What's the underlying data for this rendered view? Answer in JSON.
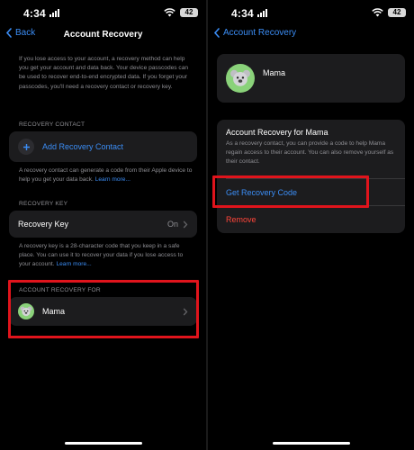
{
  "status_bar": {
    "time": "4:34",
    "battery": "42"
  },
  "left": {
    "back_label": "Back",
    "title": "Account Recovery",
    "intro": "If you lose access to your account, a recovery method can help you get your account and data back. Your device passcodes can be used to recover end-to-end encrypted data. If you forget your passcodes, you'll need a recovery contact or recovery key.",
    "recovery_contact_header": "RECOVERY CONTACT",
    "add_contact_label": "Add Recovery Contact",
    "contact_footer_text": "A recovery contact can generate a code from their Apple device to help you get your data back.",
    "learn_more": "Learn more...",
    "recovery_key_header": "RECOVERY KEY",
    "recovery_key_label": "Recovery Key",
    "recovery_key_value": "On",
    "key_footer_text": "A recovery key is a 28-character code that you keep in a safe place. You can use it to recover your data if you lose access to your account.",
    "account_recovery_for_header": "ACCOUNT RECOVERY FOR",
    "contact_name": "Mama"
  },
  "right": {
    "back_label": "Account Recovery",
    "contact_name": "Mama",
    "info_title": "Account Recovery for Mama",
    "info_desc": "As a recovery contact, you can provide a code to help Mama regain access to their account. You can also remove yourself as their contact.",
    "get_code_label": "Get Recovery Code",
    "remove_label": "Remove"
  },
  "colors": {
    "accent": "#3b8df5",
    "destructive": "#ff453a",
    "highlight": "#e0141c",
    "card": "#1c1c1e",
    "background": "#000000"
  }
}
